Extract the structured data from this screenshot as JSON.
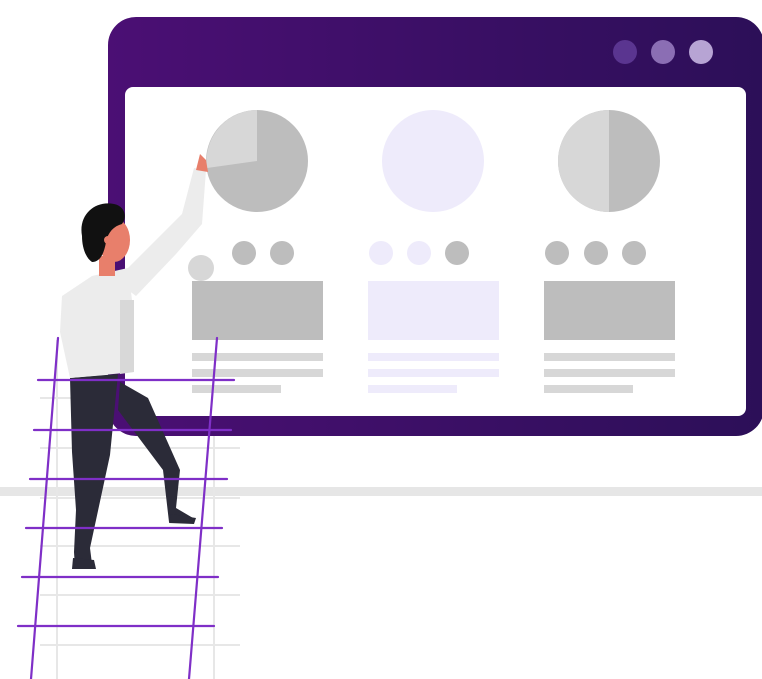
{
  "illustration": {
    "subject": "person-on-ladder-dashboard",
    "colors": {
      "window_gradient_start": "#4b0f74",
      "window_gradient_end": "#2c0f58",
      "window_dot_dark": "#5a3590",
      "window_dot_mid": "#8b6eb4",
      "window_dot_light": "#b7a4d4",
      "screen": "#ffffff",
      "placeholder_gray": "#bdbdbd",
      "placeholder_gray_light": "#d7d7d7",
      "placeholder_lavender": "#eeebfb",
      "ladder": "#7f2fc7",
      "ladder_shadow": "#e7e7e7",
      "floor_line": "#e6e6e6",
      "shirt": "#ececec",
      "shirt_shadow": "#d8d8d8",
      "pants": "#2b2b38",
      "skin": "#e87f6b",
      "hair": "#111111"
    },
    "window_dots": [
      "dot-dark",
      "dot-mid",
      "dot-light"
    ],
    "panels": [
      {
        "name": "left",
        "pie": "partial-slice",
        "dots": [
          "gray",
          "gray"
        ],
        "theme": "gray"
      },
      {
        "name": "middle",
        "pie": "empty",
        "dots": [
          "lavender",
          "lavender",
          "gray"
        ],
        "theme": "lavender"
      },
      {
        "name": "right",
        "pie": "half",
        "dots": [
          "gray",
          "gray",
          "gray"
        ],
        "theme": "gray"
      }
    ]
  }
}
